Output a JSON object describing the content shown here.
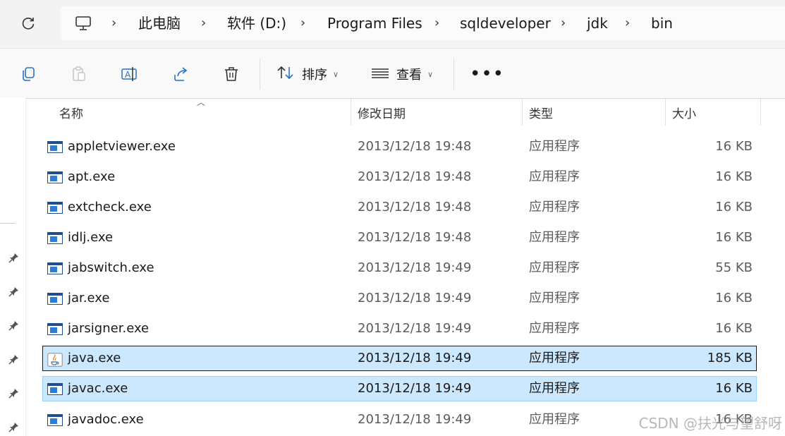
{
  "address_bar": {
    "breadcrumbs": [
      "此电脑",
      "软件 (D:)",
      "Program Files",
      "sqldeveloper",
      "jdk",
      "bin"
    ]
  },
  "toolbar": {
    "sort_label": "排序",
    "view_label": "查看",
    "more_label": "•••"
  },
  "columns": {
    "name": "名称",
    "date": "修改日期",
    "type": "类型",
    "size": "大小"
  },
  "files": [
    {
      "name": "appletviewer.exe",
      "date": "2013/12/18 19:48",
      "type": "应用程序",
      "size": "16 KB",
      "icon": "exe-icon"
    },
    {
      "name": "apt.exe",
      "date": "2013/12/18 19:48",
      "type": "应用程序",
      "size": "16 KB",
      "icon": "exe-icon"
    },
    {
      "name": "extcheck.exe",
      "date": "2013/12/18 19:48",
      "type": "应用程序",
      "size": "16 KB",
      "icon": "exe-icon"
    },
    {
      "name": "idlj.exe",
      "date": "2013/12/18 19:48",
      "type": "应用程序",
      "size": "16 KB",
      "icon": "exe-icon"
    },
    {
      "name": "jabswitch.exe",
      "date": "2013/12/18 19:49",
      "type": "应用程序",
      "size": "55 KB",
      "icon": "exe-icon"
    },
    {
      "name": "jar.exe",
      "date": "2013/12/18 19:49",
      "type": "应用程序",
      "size": "16 KB",
      "icon": "exe-icon"
    },
    {
      "name": "jarsigner.exe",
      "date": "2013/12/18 19:49",
      "type": "应用程序",
      "size": "16 KB",
      "icon": "exe-icon"
    },
    {
      "name": "java.exe",
      "date": "2013/12/18 19:49",
      "type": "应用程序",
      "size": "185 KB",
      "icon": "java-icon",
      "selected": true,
      "focused": true
    },
    {
      "name": "javac.exe",
      "date": "2013/12/18 19:49",
      "type": "应用程序",
      "size": "16 KB",
      "icon": "exe-icon",
      "selected": true
    },
    {
      "name": "javadoc.exe",
      "date": "2013/12/18 19:49",
      "type": "应用程序",
      "size": "16 KB",
      "icon": "exe-icon"
    }
  ],
  "watermark": "CSDN @扶光与望舒呀",
  "colors": {
    "selection_bg": "#cce8ff",
    "selection_border": "#99d1ff",
    "exe_icon_blue": "#2a7fd4"
  }
}
